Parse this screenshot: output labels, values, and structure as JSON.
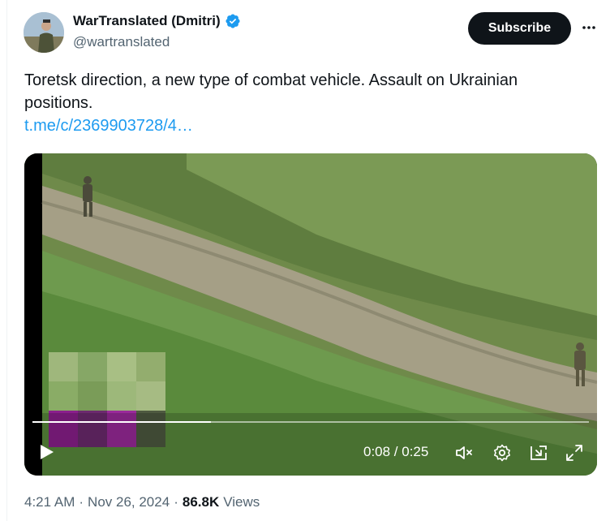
{
  "post": {
    "author": {
      "display_name": "WarTranslated (Dmitri)",
      "handle": "@wartranslated",
      "verified": true,
      "avatar_icon": "avatar-soldier-photo"
    },
    "subscribe_label": "Subscribe",
    "more_icon": "more-horizontal-icon",
    "text": "Toretsk direction, a new type of combat vehicle. Assault on Ukrainian positions.",
    "link": "t.me/c/2369903728/4…",
    "video": {
      "current_time": "0:08",
      "duration": "0:25",
      "time_display": "0:08 / 0:25",
      "progress": 0.32,
      "controls": [
        "play-icon",
        "mute-icon",
        "settings-gear-icon",
        "popout-icon",
        "fullscreen-icon"
      ]
    },
    "meta": {
      "time": "4:21 AM",
      "separator": "·",
      "date": "Nov 26, 2024",
      "views_count": "86.8K",
      "views_label": "Views"
    }
  },
  "colors": {
    "accent": "#1d9bf0",
    "text_primary": "#0f1419",
    "text_secondary": "#536471",
    "button_bg": "#0f1419"
  }
}
